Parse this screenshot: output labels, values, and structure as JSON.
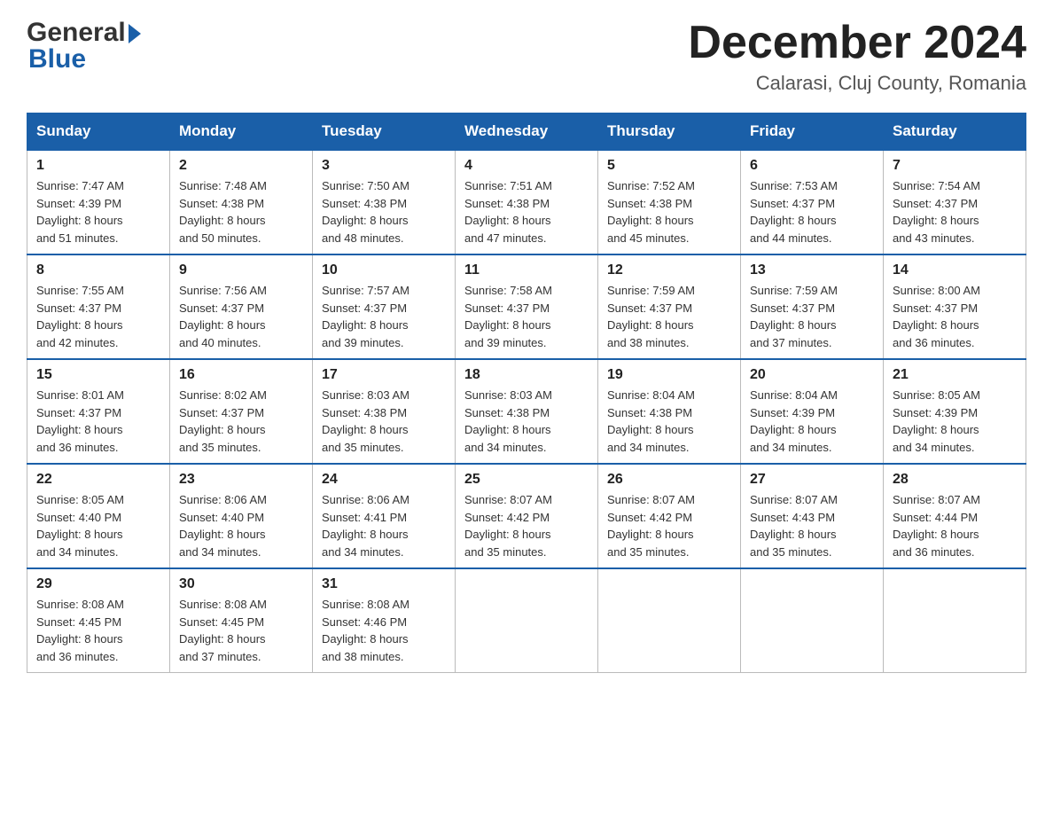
{
  "header": {
    "title": "December 2024",
    "location": "Calarasi, Cluj County, Romania",
    "logo_general": "General",
    "logo_blue": "Blue"
  },
  "days_of_week": [
    "Sunday",
    "Monday",
    "Tuesday",
    "Wednesday",
    "Thursday",
    "Friday",
    "Saturday"
  ],
  "weeks": [
    [
      {
        "day": "1",
        "sunrise": "7:47 AM",
        "sunset": "4:39 PM",
        "daylight": "8 hours and 51 minutes."
      },
      {
        "day": "2",
        "sunrise": "7:48 AM",
        "sunset": "4:38 PM",
        "daylight": "8 hours and 50 minutes."
      },
      {
        "day": "3",
        "sunrise": "7:50 AM",
        "sunset": "4:38 PM",
        "daylight": "8 hours and 48 minutes."
      },
      {
        "day": "4",
        "sunrise": "7:51 AM",
        "sunset": "4:38 PM",
        "daylight": "8 hours and 47 minutes."
      },
      {
        "day": "5",
        "sunrise": "7:52 AM",
        "sunset": "4:38 PM",
        "daylight": "8 hours and 45 minutes."
      },
      {
        "day": "6",
        "sunrise": "7:53 AM",
        "sunset": "4:37 PM",
        "daylight": "8 hours and 44 minutes."
      },
      {
        "day": "7",
        "sunrise": "7:54 AM",
        "sunset": "4:37 PM",
        "daylight": "8 hours and 43 minutes."
      }
    ],
    [
      {
        "day": "8",
        "sunrise": "7:55 AM",
        "sunset": "4:37 PM",
        "daylight": "8 hours and 42 minutes."
      },
      {
        "day": "9",
        "sunrise": "7:56 AM",
        "sunset": "4:37 PM",
        "daylight": "8 hours and 40 minutes."
      },
      {
        "day": "10",
        "sunrise": "7:57 AM",
        "sunset": "4:37 PM",
        "daylight": "8 hours and 39 minutes."
      },
      {
        "day": "11",
        "sunrise": "7:58 AM",
        "sunset": "4:37 PM",
        "daylight": "8 hours and 39 minutes."
      },
      {
        "day": "12",
        "sunrise": "7:59 AM",
        "sunset": "4:37 PM",
        "daylight": "8 hours and 38 minutes."
      },
      {
        "day": "13",
        "sunrise": "7:59 AM",
        "sunset": "4:37 PM",
        "daylight": "8 hours and 37 minutes."
      },
      {
        "day": "14",
        "sunrise": "8:00 AM",
        "sunset": "4:37 PM",
        "daylight": "8 hours and 36 minutes."
      }
    ],
    [
      {
        "day": "15",
        "sunrise": "8:01 AM",
        "sunset": "4:37 PM",
        "daylight": "8 hours and 36 minutes."
      },
      {
        "day": "16",
        "sunrise": "8:02 AM",
        "sunset": "4:37 PM",
        "daylight": "8 hours and 35 minutes."
      },
      {
        "day": "17",
        "sunrise": "8:03 AM",
        "sunset": "4:38 PM",
        "daylight": "8 hours and 35 minutes."
      },
      {
        "day": "18",
        "sunrise": "8:03 AM",
        "sunset": "4:38 PM",
        "daylight": "8 hours and 34 minutes."
      },
      {
        "day": "19",
        "sunrise": "8:04 AM",
        "sunset": "4:38 PM",
        "daylight": "8 hours and 34 minutes."
      },
      {
        "day": "20",
        "sunrise": "8:04 AM",
        "sunset": "4:39 PM",
        "daylight": "8 hours and 34 minutes."
      },
      {
        "day": "21",
        "sunrise": "8:05 AM",
        "sunset": "4:39 PM",
        "daylight": "8 hours and 34 minutes."
      }
    ],
    [
      {
        "day": "22",
        "sunrise": "8:05 AM",
        "sunset": "4:40 PM",
        "daylight": "8 hours and 34 minutes."
      },
      {
        "day": "23",
        "sunrise": "8:06 AM",
        "sunset": "4:40 PM",
        "daylight": "8 hours and 34 minutes."
      },
      {
        "day": "24",
        "sunrise": "8:06 AM",
        "sunset": "4:41 PM",
        "daylight": "8 hours and 34 minutes."
      },
      {
        "day": "25",
        "sunrise": "8:07 AM",
        "sunset": "4:42 PM",
        "daylight": "8 hours and 35 minutes."
      },
      {
        "day": "26",
        "sunrise": "8:07 AM",
        "sunset": "4:42 PM",
        "daylight": "8 hours and 35 minutes."
      },
      {
        "day": "27",
        "sunrise": "8:07 AM",
        "sunset": "4:43 PM",
        "daylight": "8 hours and 35 minutes."
      },
      {
        "day": "28",
        "sunrise": "8:07 AM",
        "sunset": "4:44 PM",
        "daylight": "8 hours and 36 minutes."
      }
    ],
    [
      {
        "day": "29",
        "sunrise": "8:08 AM",
        "sunset": "4:45 PM",
        "daylight": "8 hours and 36 minutes."
      },
      {
        "day": "30",
        "sunrise": "8:08 AM",
        "sunset": "4:45 PM",
        "daylight": "8 hours and 37 minutes."
      },
      {
        "day": "31",
        "sunrise": "8:08 AM",
        "sunset": "4:46 PM",
        "daylight": "8 hours and 38 minutes."
      },
      null,
      null,
      null,
      null
    ]
  ],
  "labels": {
    "sunrise": "Sunrise:",
    "sunset": "Sunset:",
    "daylight": "Daylight:"
  }
}
